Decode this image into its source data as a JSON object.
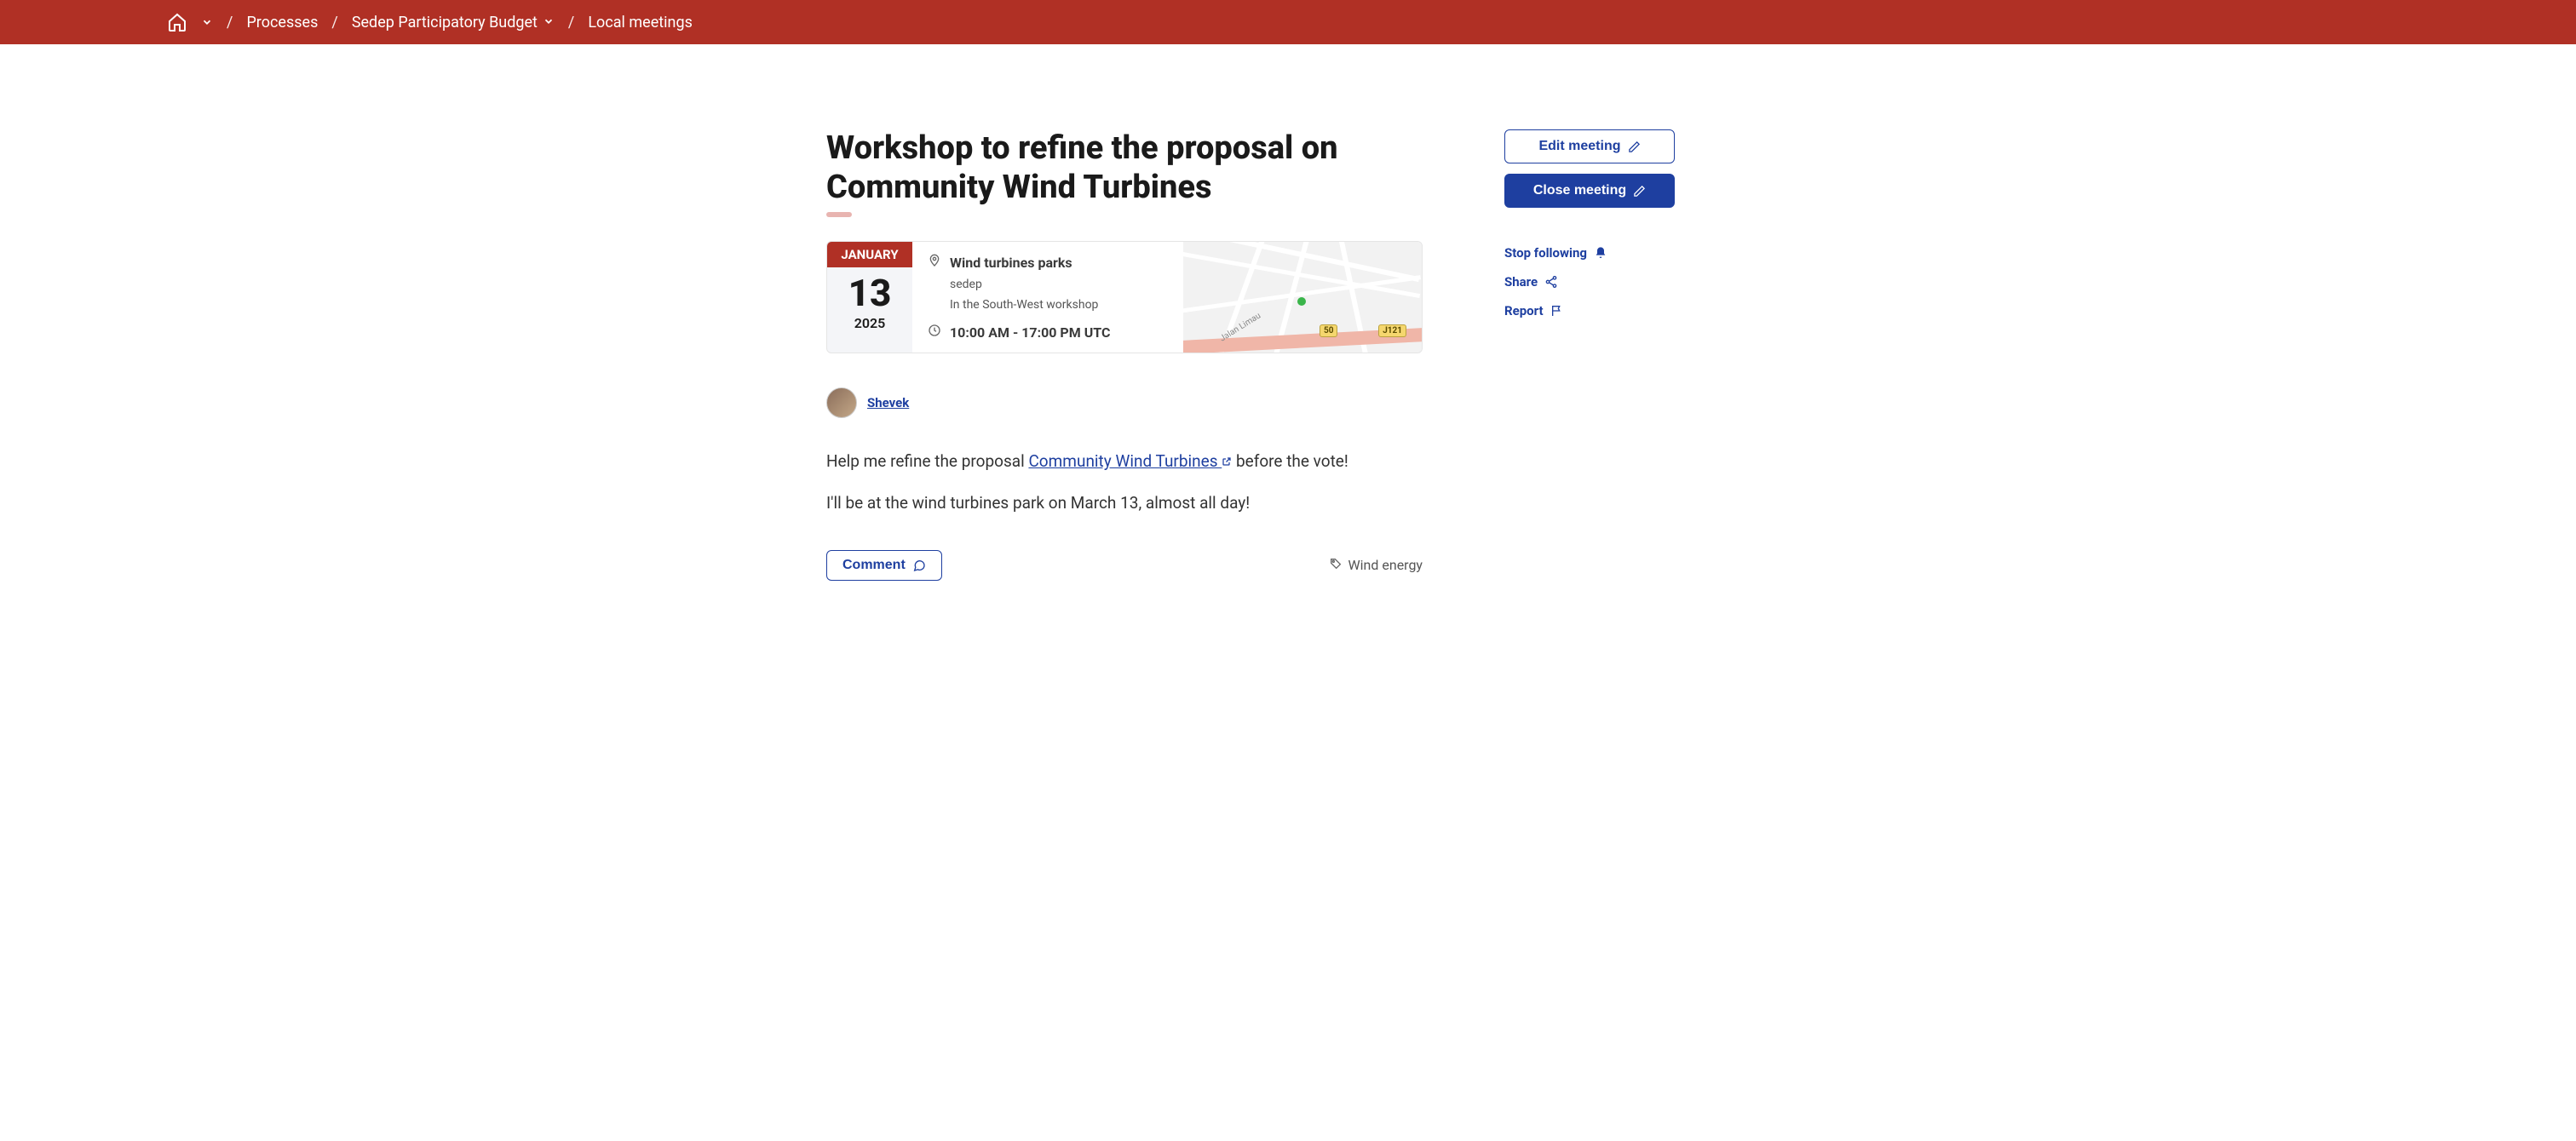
{
  "breadcrumb": {
    "items": [
      {
        "label": "Processes"
      },
      {
        "label": "Sedep Participatory Budget"
      },
      {
        "label": "Local meetings"
      }
    ]
  },
  "page": {
    "title": "Workshop to refine the proposal on Community Wind Turbines"
  },
  "event": {
    "month": "JANUARY",
    "day": "13",
    "year": "2025",
    "location_name": "Wind turbines parks",
    "location_sub1": "sedep",
    "location_sub2": "In the South-West workshop",
    "time": "10:00 AM - 17:00 PM UTC",
    "map": {
      "street_label": "Jalan Limau",
      "badge1": "50",
      "badge2": "J121"
    }
  },
  "author": {
    "name": "Shevek"
  },
  "body": {
    "intro_prefix": "Help me refine the proposal ",
    "link_text": "Community Wind Turbines ",
    "intro_suffix": "before the vote!",
    "line2": "I'll be at the wind turbines park on March 13, almost all day!"
  },
  "actions": {
    "comment_label": "Comment",
    "tag": "Wind energy"
  },
  "sidebar": {
    "edit_label": "Edit meeting",
    "close_label": "Close meeting",
    "follow_label": "Stop following",
    "share_label": "Share",
    "report_label": "Report"
  }
}
